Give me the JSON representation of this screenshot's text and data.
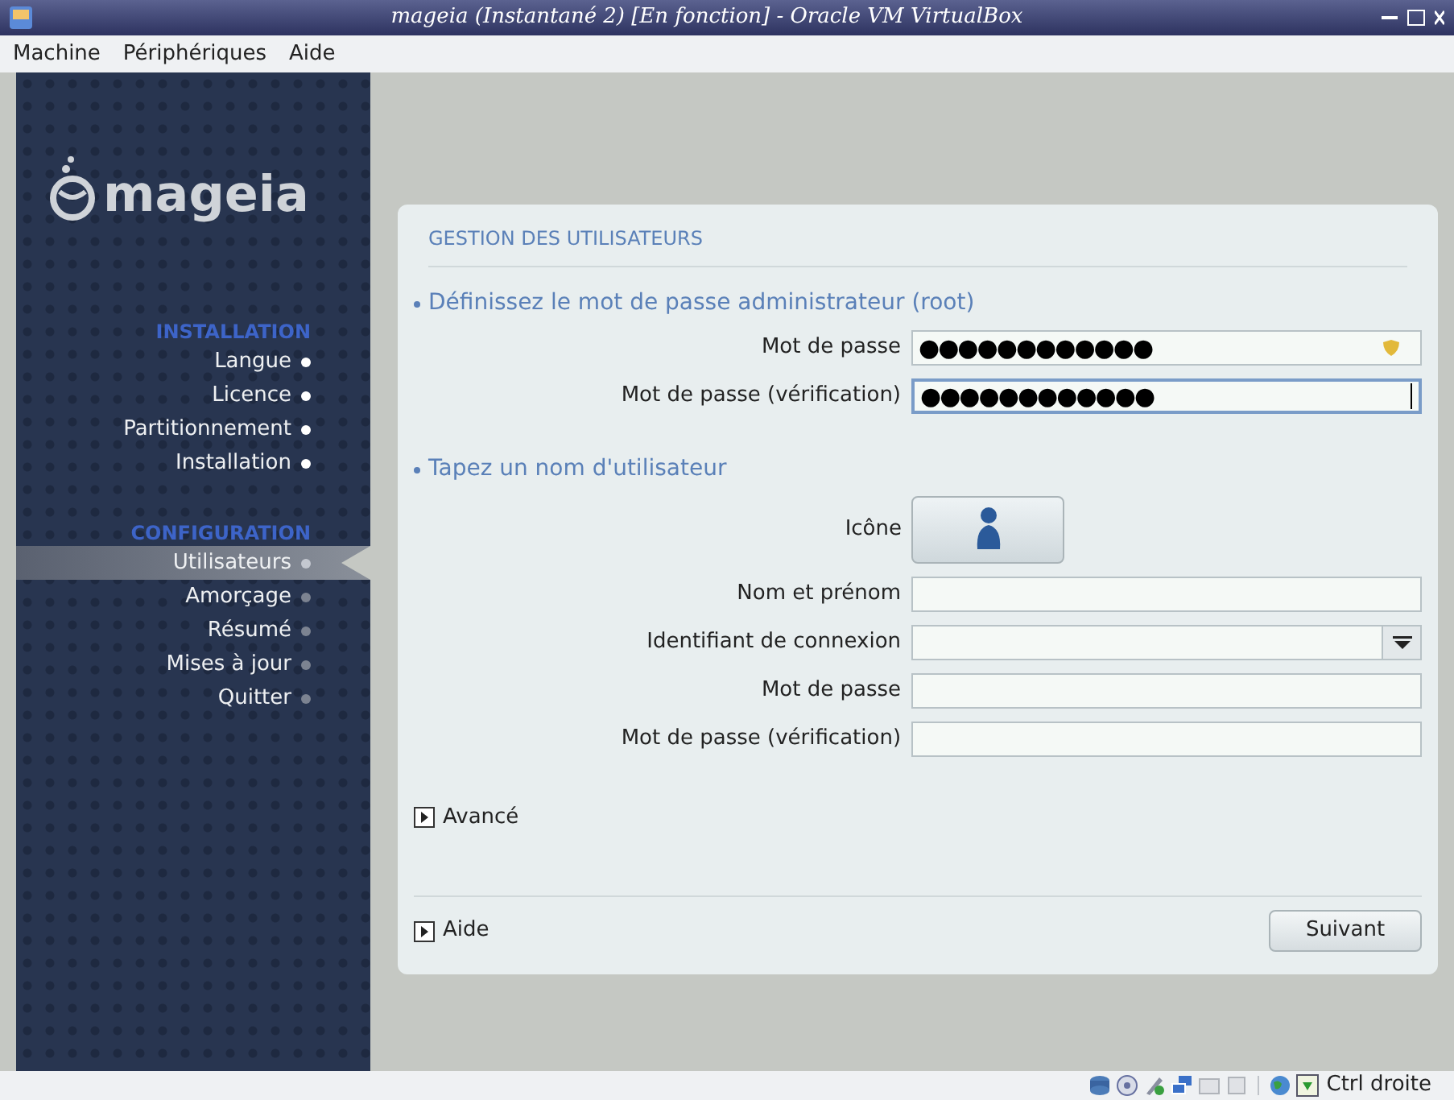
{
  "window": {
    "title": "mageia (Instantané 2) [En fonction] - Oracle VM VirtualBox"
  },
  "menu": [
    "Machine",
    "Périphériques",
    "Aide"
  ],
  "sidebar": {
    "logo": "mageia",
    "sections": [
      {
        "title": "INSTALLATION",
        "items": [
          {
            "label": "Langue",
            "done": true,
            "selected": false
          },
          {
            "label": "Licence",
            "done": true,
            "selected": false
          },
          {
            "label": "Partitionnement",
            "done": true,
            "selected": false
          },
          {
            "label": "Installation",
            "done": true,
            "selected": false
          }
        ]
      },
      {
        "title": "CONFIGURATION",
        "items": [
          {
            "label": "Utilisateurs",
            "done": false,
            "selected": true
          },
          {
            "label": "Amorçage",
            "done": false,
            "selected": false
          },
          {
            "label": "Résumé",
            "done": false,
            "selected": false
          },
          {
            "label": "Mises à jour",
            "done": false,
            "selected": false
          },
          {
            "label": "Quitter",
            "done": false,
            "selected": false
          }
        ]
      }
    ]
  },
  "panel": {
    "title": "GESTION DES UTILISATEURS",
    "sections": [
      {
        "heading": "Définissez le mot de passe administrateur (root)",
        "fields": [
          {
            "kind": "password",
            "label": "Mot de passe",
            "value": "●●●●●●●●●●●●",
            "warning": true,
            "focused": false
          },
          {
            "kind": "password",
            "label": "Mot de passe (vérification)",
            "value": "●●●●●●●●●●●●",
            "warning": false,
            "focused": true
          }
        ]
      },
      {
        "heading": "Tapez un nom d'utilisateur",
        "fields": [
          {
            "kind": "icon",
            "label": "Icône"
          },
          {
            "kind": "text",
            "label": "Nom et prénom"
          },
          {
            "kind": "combo",
            "label": "Identifiant de connexion"
          },
          {
            "kind": "text",
            "label": "Mot de passe"
          },
          {
            "kind": "text",
            "label": "Mot de passe (vérification)"
          }
        ]
      }
    ],
    "advanced": "Avancé",
    "help": "Aide",
    "next_button": "Suivant"
  },
  "status_bar": {
    "hint": "Ctrl droite"
  }
}
